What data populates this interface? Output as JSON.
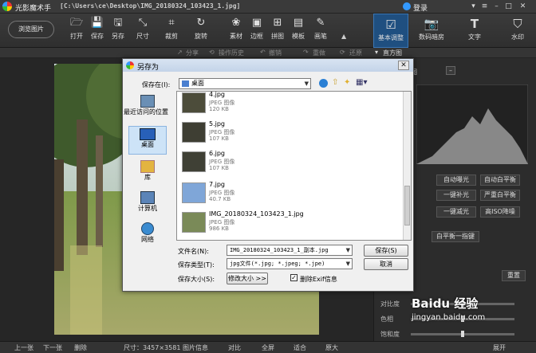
{
  "app": {
    "name": "光影魔术手",
    "path": "[C:\\Users\\ce\\Desktop\\IMG_20180324_103423_1.jpg]",
    "login": "登录"
  },
  "toolbar": {
    "browse": "浏览图片",
    "tools": [
      {
        "label": "打开",
        "icon": "folder-icon"
      },
      {
        "label": "保存",
        "icon": "save-icon"
      },
      {
        "label": "另存",
        "icon": "save-as-icon"
      },
      {
        "label": "尺寸",
        "icon": "resize-icon"
      },
      {
        "label": "裁剪",
        "icon": "crop-icon"
      },
      {
        "label": "旋转",
        "icon": "rotate-icon"
      },
      {
        "label": "素材",
        "icon": "material-icon"
      },
      {
        "label": "边框",
        "icon": "frame-icon"
      },
      {
        "label": "拼图",
        "icon": "collage-icon"
      },
      {
        "label": "模板",
        "icon": "template-icon"
      },
      {
        "label": "画笔",
        "icon": "brush-icon"
      }
    ],
    "right_tabs": [
      {
        "label": "基本调整",
        "icon": "adjust-icon",
        "active": true
      },
      {
        "label": "数码暗房",
        "icon": "darkroom-icon",
        "active": false
      },
      {
        "label": "文字",
        "icon": "text-icon",
        "active": false
      },
      {
        "label": "水印",
        "icon": "watermark-icon",
        "active": false
      }
    ]
  },
  "subbar": {
    "share": "分享",
    "history": "操作历史",
    "undo": "撤销",
    "redo": "重做",
    "restore": "还原",
    "histogram": "直方图"
  },
  "right_panel": {
    "histogram_label": "直方图",
    "buttons_row1": [
      "自动曝光",
      "自动白平衡"
    ],
    "buttons_row2": [
      "一键补光",
      "严重白平衡"
    ],
    "buttons_row3": [
      "一键减光",
      "高ISO降噪"
    ],
    "buttons_row4": [
      "白平衡一指键"
    ],
    "reset": "重置",
    "sliders": [
      {
        "label": "对比度",
        "value": 0.5
      },
      {
        "label": "色相",
        "value": 0.5
      },
      {
        "label": "饱和度",
        "value": 0.5
      }
    ]
  },
  "bottombar": {
    "prev": "上一张",
    "next": "下一张",
    "delete": "删除",
    "size": "尺寸：3457×3581",
    "info": "图片信息",
    "compare": "对比",
    "fullscreen": "全屏",
    "zoom_fit": "适合",
    "original": "原大",
    "expand": "展开"
  },
  "dialog": {
    "title": "另存为",
    "save_in_label": "保存在(I):",
    "save_in_value": "桌面",
    "places": [
      "最近访问的位置",
      "桌面",
      "库",
      "计算机",
      "网络"
    ],
    "files": [
      {
        "name": "4.jpg",
        "type": "JPEG 图像",
        "size": "120 KB"
      },
      {
        "name": "5.jpg",
        "type": "JPEG 图像",
        "size": "107 KB"
      },
      {
        "name": "6.jpg",
        "type": "JPEG 图像",
        "size": "107 KB"
      },
      {
        "name": "7.jpg",
        "type": "JPEG 图像",
        "size": "40.7 KB"
      },
      {
        "name": "IMG_20180324_103423_1.jpg",
        "type": "JPEG 图像",
        "size": "986 KB"
      }
    ],
    "filename_label": "文件名(N):",
    "filename_value": "IMG_20180324_103423_1_副本.jpg",
    "filetype_label": "保存类型(T):",
    "filetype_value": "jpg文件(*.jpg; *.jpeg; *.jpe)",
    "savesize_label": "保存大小(S):",
    "resize_btn": "修改大小 >>",
    "exif_label": "删除Exif信息",
    "save_btn": "保存(S)",
    "cancel_btn": "取消"
  },
  "watermark": {
    "brand": "Baidu 经验",
    "url": "jingyan.baidu.com"
  }
}
